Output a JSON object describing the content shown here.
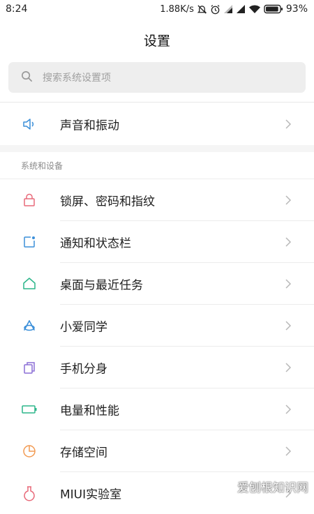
{
  "status_bar": {
    "time": "8:24",
    "speed": "1.88K/s",
    "battery": "93%",
    "battery_level": 0.93
  },
  "header": {
    "title": "设置"
  },
  "search": {
    "placeholder": "搜索系统设置项"
  },
  "items_top": [
    {
      "label": "声音和振动",
      "icon": "speaker-icon",
      "color": "#3b8fd9"
    }
  ],
  "section": {
    "title": "系统和设备"
  },
  "items": [
    {
      "label": "锁屏、密码和指纹",
      "icon": "lock-icon",
      "color": "#e86a7a"
    },
    {
      "label": "通知和状态栏",
      "icon": "notification-icon",
      "color": "#3b8fd9"
    },
    {
      "label": "桌面与最近任务",
      "icon": "home-icon",
      "color": "#2cb58a"
    },
    {
      "label": "小爱同学",
      "icon": "xiaoai-icon",
      "color": "#3b8fd9"
    },
    {
      "label": "手机分身",
      "icon": "second-space-icon",
      "color": "#8b6fd6"
    },
    {
      "label": "电量和性能",
      "icon": "battery-icon",
      "color": "#2cb58a"
    },
    {
      "label": "存储空间",
      "icon": "storage-icon",
      "color": "#f29a52"
    },
    {
      "label": "MIUI实验室",
      "icon": "flask-icon",
      "color": "#e86a7a"
    }
  ],
  "watermark": "爱刨根知识网"
}
